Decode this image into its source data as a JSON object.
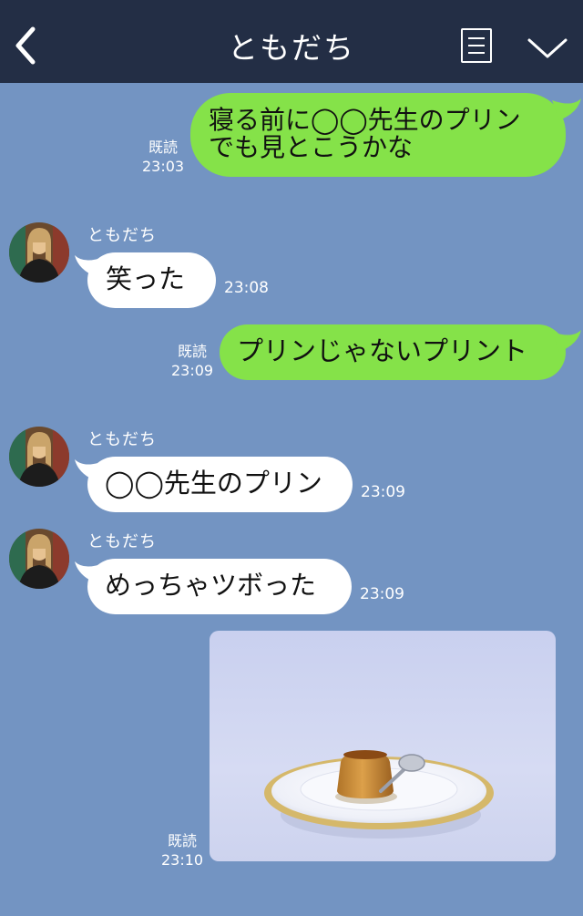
{
  "header": {
    "title": "ともだち",
    "back_icon": "chevron-left-icon",
    "menu_icon": "list-icon",
    "collapse_icon": "chevron-down-icon"
  },
  "colors": {
    "header_bg": "#232e45",
    "chat_bg": "#7394c2",
    "outgoing_bubble": "#85e249",
    "incoming_bubble": "#ffffff"
  },
  "messages": [
    {
      "direction": "out",
      "lines": [
        "寝る前に◯◯先生のプリン",
        "でも見とこうかな"
      ],
      "read": "既読",
      "time": "23:03"
    },
    {
      "direction": "in",
      "sender": "ともだち",
      "text": "笑った",
      "time": "23:08"
    },
    {
      "direction": "out",
      "text": "プリンじゃないプリント",
      "read": "既読",
      "time": "23:09"
    },
    {
      "direction": "in",
      "sender": "ともだち",
      "text": "◯◯先生のプリン",
      "time": "23:09"
    },
    {
      "direction": "in",
      "sender": "ともだち",
      "text": "めっちゃツボった",
      "time": "23:09"
    },
    {
      "direction": "out",
      "type": "image",
      "image": "pudding-on-plate-photo",
      "read": "既読",
      "time": "23:10"
    }
  ]
}
